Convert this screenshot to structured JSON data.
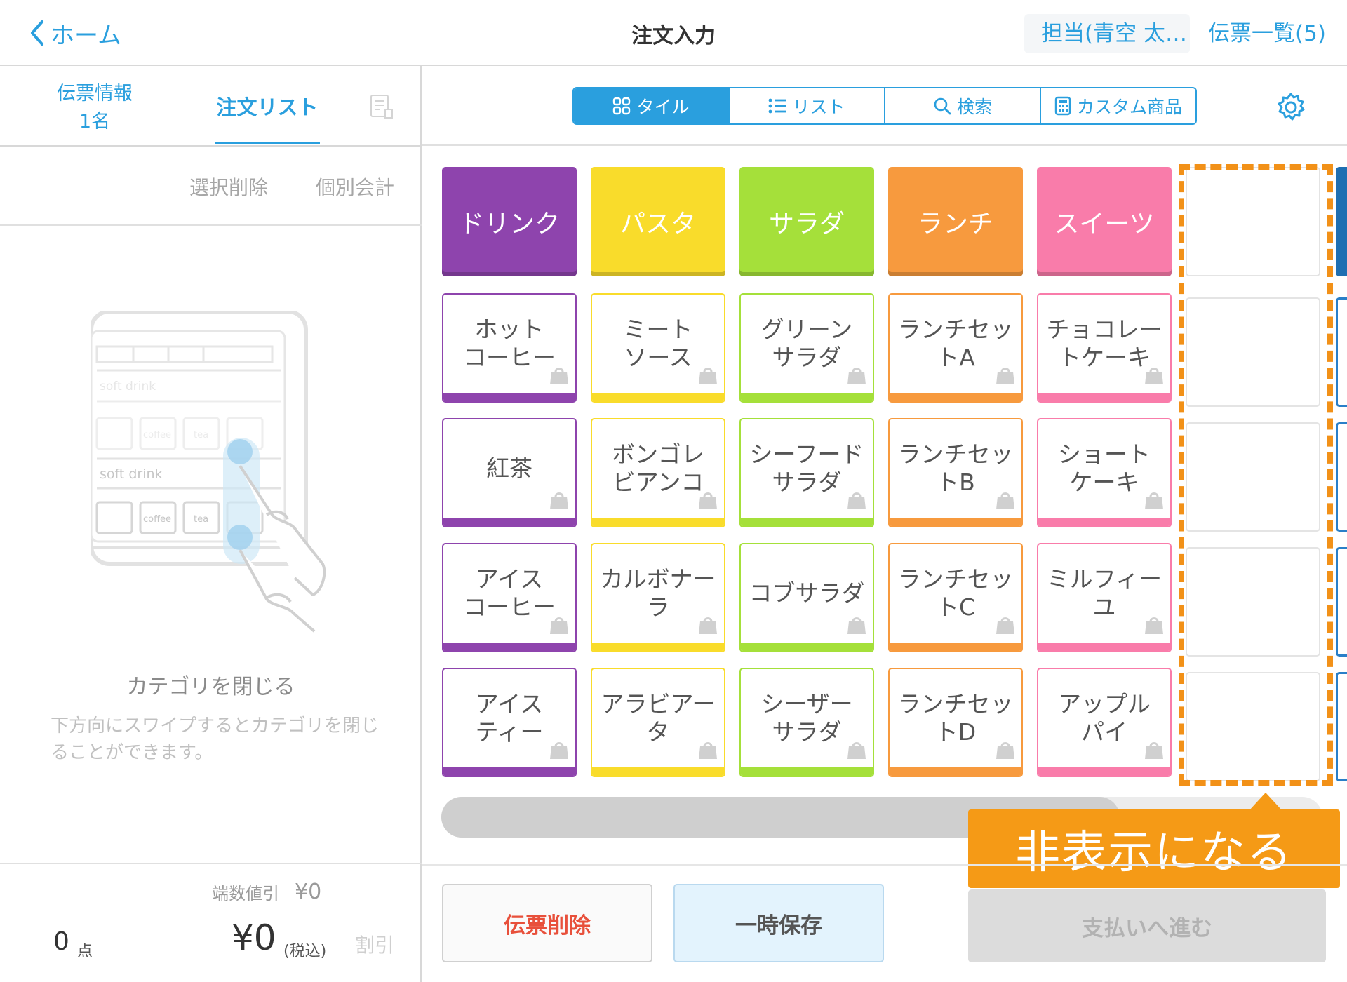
{
  "header": {
    "back_label": "ホーム",
    "title": "注文入力",
    "staff": "担当(青空 太…",
    "slip_list": "伝票一覧(5)"
  },
  "left_panel": {
    "tab_info_line1": "伝票情報",
    "tab_info_line2": "1名",
    "tab_order_list": "注文リスト",
    "action_delete": "選択削除",
    "action_split": "個別会計",
    "illustration_texts": [
      "soft drink",
      "coffee",
      "tea",
      "soft drink",
      "coffee",
      "tea"
    ],
    "close_title": "カテゴリを閉じる",
    "close_desc": "下方向にスワイプするとカテゴリを閉じることができます。",
    "rounding_label": "端数値引",
    "rounding_value": "¥0",
    "count_value": "0",
    "count_unit": "点",
    "total": "¥0",
    "tax_note": "(税込)",
    "discount": "割引"
  },
  "view_tabs": [
    "タイル",
    "リスト",
    "検索",
    "カスタム商品"
  ],
  "active_view_tab": 0,
  "categories": [
    {
      "label": "ドリンク",
      "color": "#8e44ad"
    },
    {
      "label": "パスタ",
      "color": "#f9dc2b"
    },
    {
      "label": "サラダ",
      "color": "#a5e03a"
    },
    {
      "label": "ランチ",
      "color": "#f79a3e"
    },
    {
      "label": "スイーツ",
      "color": "#f97caa"
    }
  ],
  "product_columns": [
    {
      "color": "#8e44ad",
      "items": [
        "ホット\nコーヒー",
        "紅茶",
        "アイス\nコーヒー",
        "アイス\nティー"
      ]
    },
    {
      "color": "#f9dc2b",
      "items": [
        "ミート\nソース",
        "ボンゴレ\nビアンコ",
        "カルボナー\nラ",
        "アラビアー\nタ"
      ]
    },
    {
      "color": "#a5e03a",
      "items": [
        "グリーン\nサラダ",
        "シーフード\nサラダ",
        "コブサラダ",
        "シーザー\nサラダ"
      ]
    },
    {
      "color": "#f79a3e",
      "items": [
        "ランチセッ\nトA",
        "ランチセッ\nトB",
        "ランチセッ\nトC",
        "ランチセッ\nトD"
      ]
    },
    {
      "color": "#f97caa",
      "items": [
        "チョコレー\nトケーキ",
        "ショート\nケーキ",
        "ミルフィー\nユ",
        "アップル\nパイ"
      ]
    }
  ],
  "callout_text": "非表示になる",
  "scroll_progress": 0.77,
  "buttons": {
    "delete_slip": "伝票削除",
    "hold": "一時保存",
    "pay": "支払いへ進む"
  },
  "colors": {
    "accent": "#2a9fde",
    "callout": "#f59a16",
    "danger": "#e8503b"
  }
}
